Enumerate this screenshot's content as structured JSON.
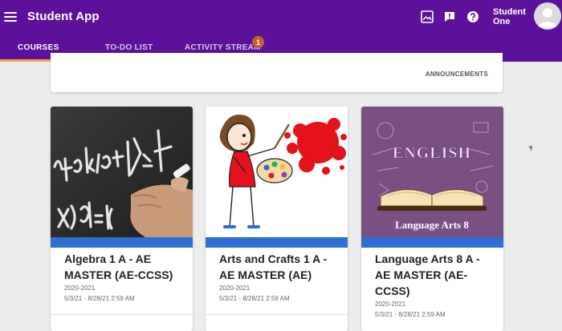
{
  "app": {
    "title": "Student App"
  },
  "header_icons": [
    "gallery-icon",
    "alert-icon",
    "help-icon"
  ],
  "user": {
    "name_line1": "Student",
    "name_line2": "One"
  },
  "tabs": [
    {
      "label": "COURSES",
      "active": true
    },
    {
      "label": "TO-DO LIST",
      "active": false
    },
    {
      "label": "ACTIVITY STREAM",
      "active": false,
      "badge": "1"
    }
  ],
  "announcements": {
    "label": "ANNOUNCEMENTS"
  },
  "courses": [
    {
      "title": "Algebra 1 A - AE MASTER (AE-CCSS)",
      "year": "2020-2021",
      "dates": "5/3/21 - 8/28/21 2:59 AM",
      "image_text": "x)dx=h("
    },
    {
      "title": "Arts and Crafts 1 A - AE MASTER (AE)",
      "year": "2020-2021",
      "dates": "5/3/21 - 8/28/21 2:59 AM"
    },
    {
      "title": "Language Arts 8 A - AE MASTER (AE-CCSS)",
      "year": "2020-2021",
      "dates": "5/3/21 - 8/28/21 2:59 AM",
      "image_banner": "Language Arts 8",
      "image_word": "ENGLISH"
    }
  ],
  "colors": {
    "appbar": "#5b119a",
    "tab_indicator": "#f5a542",
    "course_bar": "#2f6fd0",
    "badge": "#c0622c"
  }
}
